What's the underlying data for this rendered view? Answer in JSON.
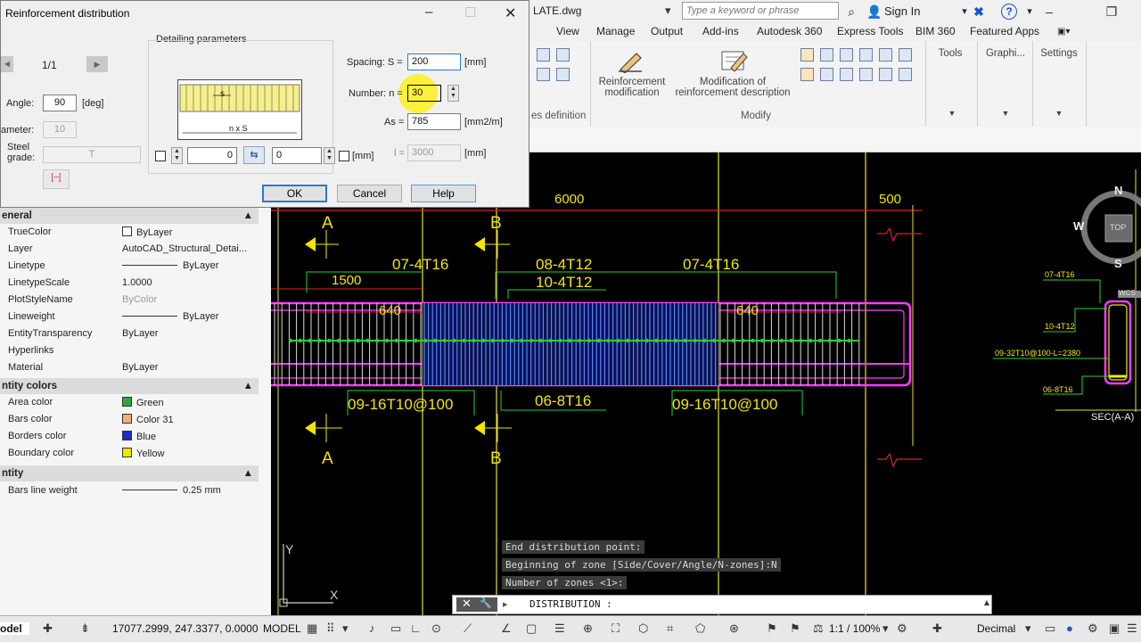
{
  "app": {
    "doc_title": "LATE.dwg",
    "search_placeholder": "Type a keyword or phrase",
    "sign_in": "Sign In"
  },
  "ribbon": {
    "tabs": [
      "View",
      "Manage",
      "Output",
      "Add-ins",
      "Autodesk 360",
      "Express Tools",
      "BIM 360",
      "Featured Apps"
    ],
    "left_panel_label": "es definition",
    "modify_panel": "Modify",
    "reinf_mod": [
      "Reinforcement",
      "modification"
    ],
    "reinf_desc": [
      "Modification of",
      "reinforcement description"
    ],
    "panels": [
      "Tools",
      "Graphi...",
      "Settings"
    ]
  },
  "dialog": {
    "title": "Reinforcement distribution",
    "page": "1/1",
    "angle_label": "Angle:",
    "angle_value": "90",
    "angle_unit": "[deg]",
    "diameter_label": "ameter:",
    "diameter_value": "10",
    "steel_label": [
      "Steel",
      "grade:"
    ],
    "steel_value": "T",
    "detailing_label": "Detailing parameters",
    "preview_top": "s",
    "preview_bottom": "n x S",
    "offset1": "0",
    "offset2": "0",
    "offset_unit": "[mm]",
    "spacing_label": "Spacing:  S =",
    "spacing_value": "200",
    "spacing_unit": "[mm]",
    "number_label": "Number:  n =",
    "number_value": "30",
    "as_label": "As =",
    "as_value": "785",
    "as_unit": "[mm2/m]",
    "l_label": "l =",
    "l_value": "3000",
    "l_unit": "[mm]",
    "ok": "OK",
    "cancel": "Cancel",
    "help": "Help"
  },
  "properties": {
    "general": {
      "header": "eneral",
      "rows": [
        {
          "name": "TrueColor",
          "value": "ByLayer"
        },
        {
          "name": "Layer",
          "value": "AutoCAD_Structural_Detai..."
        },
        {
          "name": "Linetype",
          "value": "ByLayer"
        },
        {
          "name": "LinetypeScale",
          "value": "1.0000"
        },
        {
          "name": "PlotStyleName",
          "value": "ByColor"
        },
        {
          "name": "Lineweight",
          "value": "ByLayer"
        },
        {
          "name": "EntityTransparency",
          "value": "ByLayer"
        },
        {
          "name": "Hyperlinks",
          "value": ""
        },
        {
          "name": "Material",
          "value": "ByLayer"
        }
      ]
    },
    "entity_colors": {
      "header": "ntity colors",
      "rows": [
        {
          "name": "Area color",
          "value": "Green",
          "color": "#2eaa3a"
        },
        {
          "name": "Bars color",
          "value": "Color 31",
          "color": "#f2b07a"
        },
        {
          "name": "Borders color",
          "value": "Blue",
          "color": "#1a2ad0"
        },
        {
          "name": "Boundary color",
          "value": "Yellow",
          "color": "#f2e600"
        }
      ]
    },
    "entity": {
      "header": "ntity",
      "rows": [
        {
          "name": "Bars line weight",
          "value": "0.25 mm"
        }
      ]
    }
  },
  "drawing": {
    "dim_6000": "6000",
    "dim_500": "500",
    "dim_1500": "1500",
    "dim_640_left": "640",
    "dim_640_right": "640",
    "label_0704_left": "07-4T16",
    "label_0804": "08-4T12",
    "label_1004": "10-4T12",
    "label_0704_right": "07-4T16",
    "label_0916_left": "09-16T10@100",
    "label_0608": "06-8T16",
    "label_0916_right": "09-16T10@100",
    "sec_a": "A",
    "sec_b": "B",
    "viewcube": {
      "n": "N",
      "w": "W",
      "s": "S",
      "top": "TOP"
    },
    "section": {
      "title": "SEC(A-A)",
      "l1": "07-4T16",
      "l2": "10-4T12",
      "l3": "09-32T10@100-L=2380",
      "l4": "06-8T16",
      "l5": "WCS"
    },
    "ucs_y": "Y",
    "ucs_x": "X"
  },
  "command": {
    "history": [
      "End distribution point:",
      "Beginning of zone [Side/Cover/Angle/N-zones]:N",
      "Number of zones <1>:"
    ],
    "prompt": "DISTRIBUTION :"
  },
  "statusbar": {
    "model_tab": "odel",
    "coords": "17077.2999, 247.3377, 0.0000",
    "model": "MODEL",
    "scale": "1:1 / 100%",
    "units": "Decimal"
  },
  "colors": {
    "magenta": "#ff3cff",
    "yellow": "#f2e600",
    "green": "#27d22e",
    "blue_bars": "#5b84ff",
    "dim_red": "#e02020"
  }
}
